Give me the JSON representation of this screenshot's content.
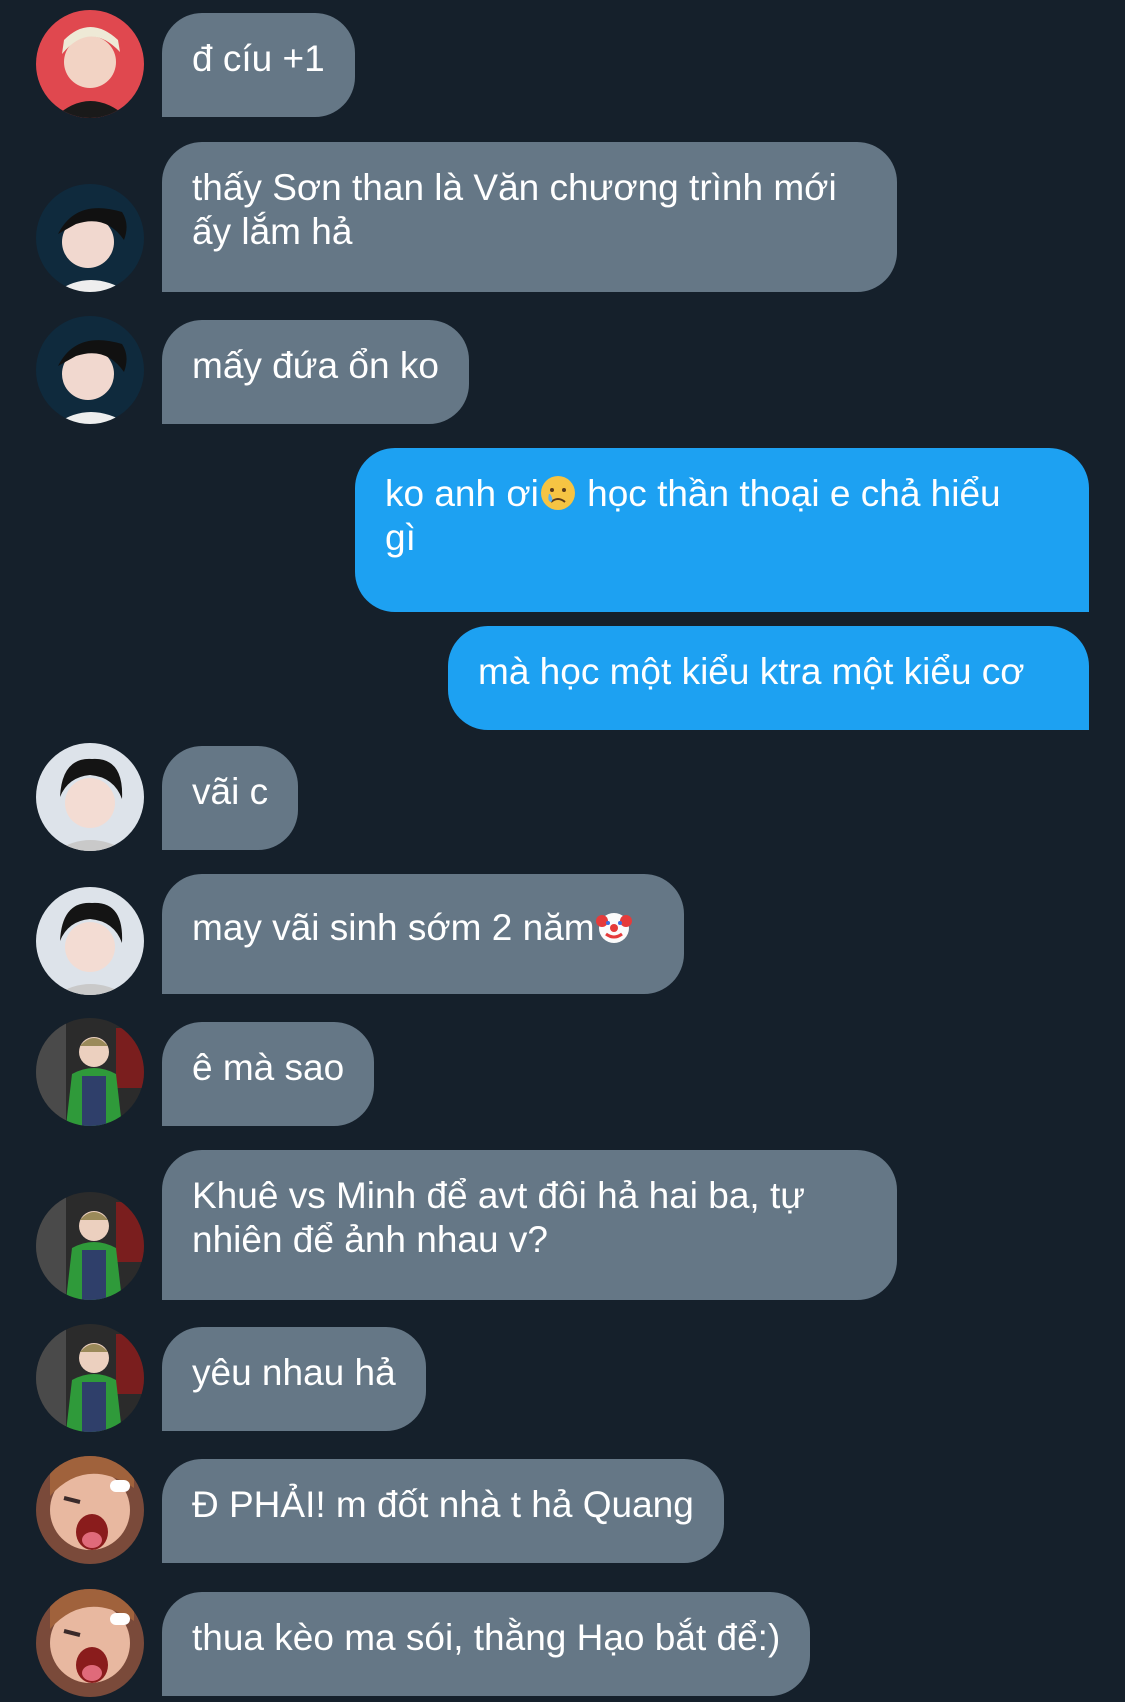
{
  "colors": {
    "background": "#15202b",
    "incoming_bubble": "#657786",
    "outgoing_bubble": "#1da1f2",
    "text": "#ffffff"
  },
  "messages": [
    {
      "direction": "incoming",
      "text": "đ cíu +1",
      "avatar": "avatar-blonde-icon"
    },
    {
      "direction": "incoming",
      "text_lines": [
        "thấy Sơn than là Văn chương trình mới",
        "ấy lắm hả"
      ],
      "avatar": "avatar-darkhair-icon"
    },
    {
      "direction": "incoming",
      "text": "mấy đứa ổn ko",
      "avatar": "avatar-darkhair-icon"
    },
    {
      "direction": "outgoing",
      "text_parts": [
        "ko anh ơi",
        " học thần thoại e chả hiểu"
      ],
      "text_line2": "gì",
      "emoji": "crying-face-icon"
    },
    {
      "direction": "outgoing",
      "text": "mà học một kiểu ktra một kiểu cơ"
    },
    {
      "direction": "incoming",
      "text": "vãi c",
      "avatar": "avatar-wavy-hair-icon"
    },
    {
      "direction": "incoming",
      "text": "may vãi sinh sớm 2 năm",
      "emoji": "clown-face-icon",
      "avatar": "avatar-wavy-hair-icon"
    },
    {
      "direction": "incoming",
      "text": "ê mà sao",
      "avatar": "avatar-green-jacket-icon"
    },
    {
      "direction": "incoming",
      "text_lines": [
        "Khuê vs Minh để avt đôi hả hai ba, tự",
        "nhiên để ảnh nhau v?"
      ],
      "avatar": "avatar-green-jacket-icon"
    },
    {
      "direction": "incoming",
      "text": "yêu nhau hả",
      "avatar": "avatar-green-jacket-icon"
    },
    {
      "direction": "incoming",
      "text": "Đ PHẢI! m đốt nhà t hả Quang",
      "avatar": "avatar-shouting-icon"
    },
    {
      "direction": "incoming",
      "text": "thua kèo ma sói, thằng Hạo bắt để:)",
      "avatar": "avatar-shouting-icon"
    }
  ]
}
